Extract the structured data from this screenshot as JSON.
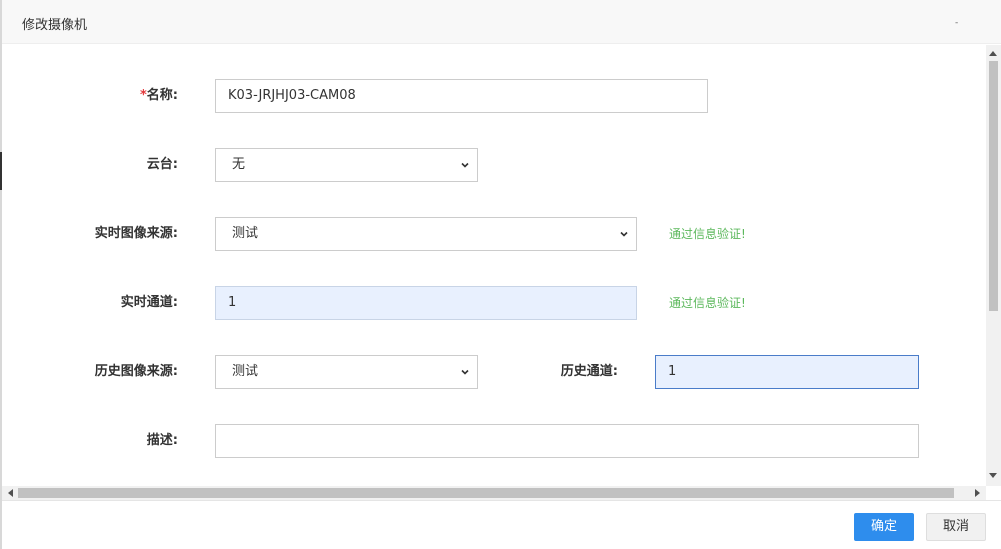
{
  "dialog": {
    "title": "修改摄像机",
    "close_glyph": "-"
  },
  "form": {
    "name": {
      "required_mark": "*",
      "label": "名称:",
      "value": "K03-JRJHJ03-CAM08"
    },
    "ptz": {
      "label": "云台:",
      "value": "无"
    },
    "live_source": {
      "label": "实时图像来源:",
      "value": "测试",
      "validation": "通过信息验证!"
    },
    "live_channel": {
      "label": "实时通道:",
      "value": "1",
      "validation": "通过信息验证!"
    },
    "history_source": {
      "label": "历史图像来源:",
      "value": "测试"
    },
    "history_channel": {
      "label": "历史通道:",
      "value": "1"
    },
    "description": {
      "label": "描述:",
      "value": ""
    }
  },
  "footer": {
    "confirm_label": "确定",
    "cancel_label": "取消"
  },
  "colors": {
    "primary": "#2e8ded",
    "valid": "#5cb85c",
    "required": "#e3393c",
    "filled_input": "#e8f0fe"
  }
}
